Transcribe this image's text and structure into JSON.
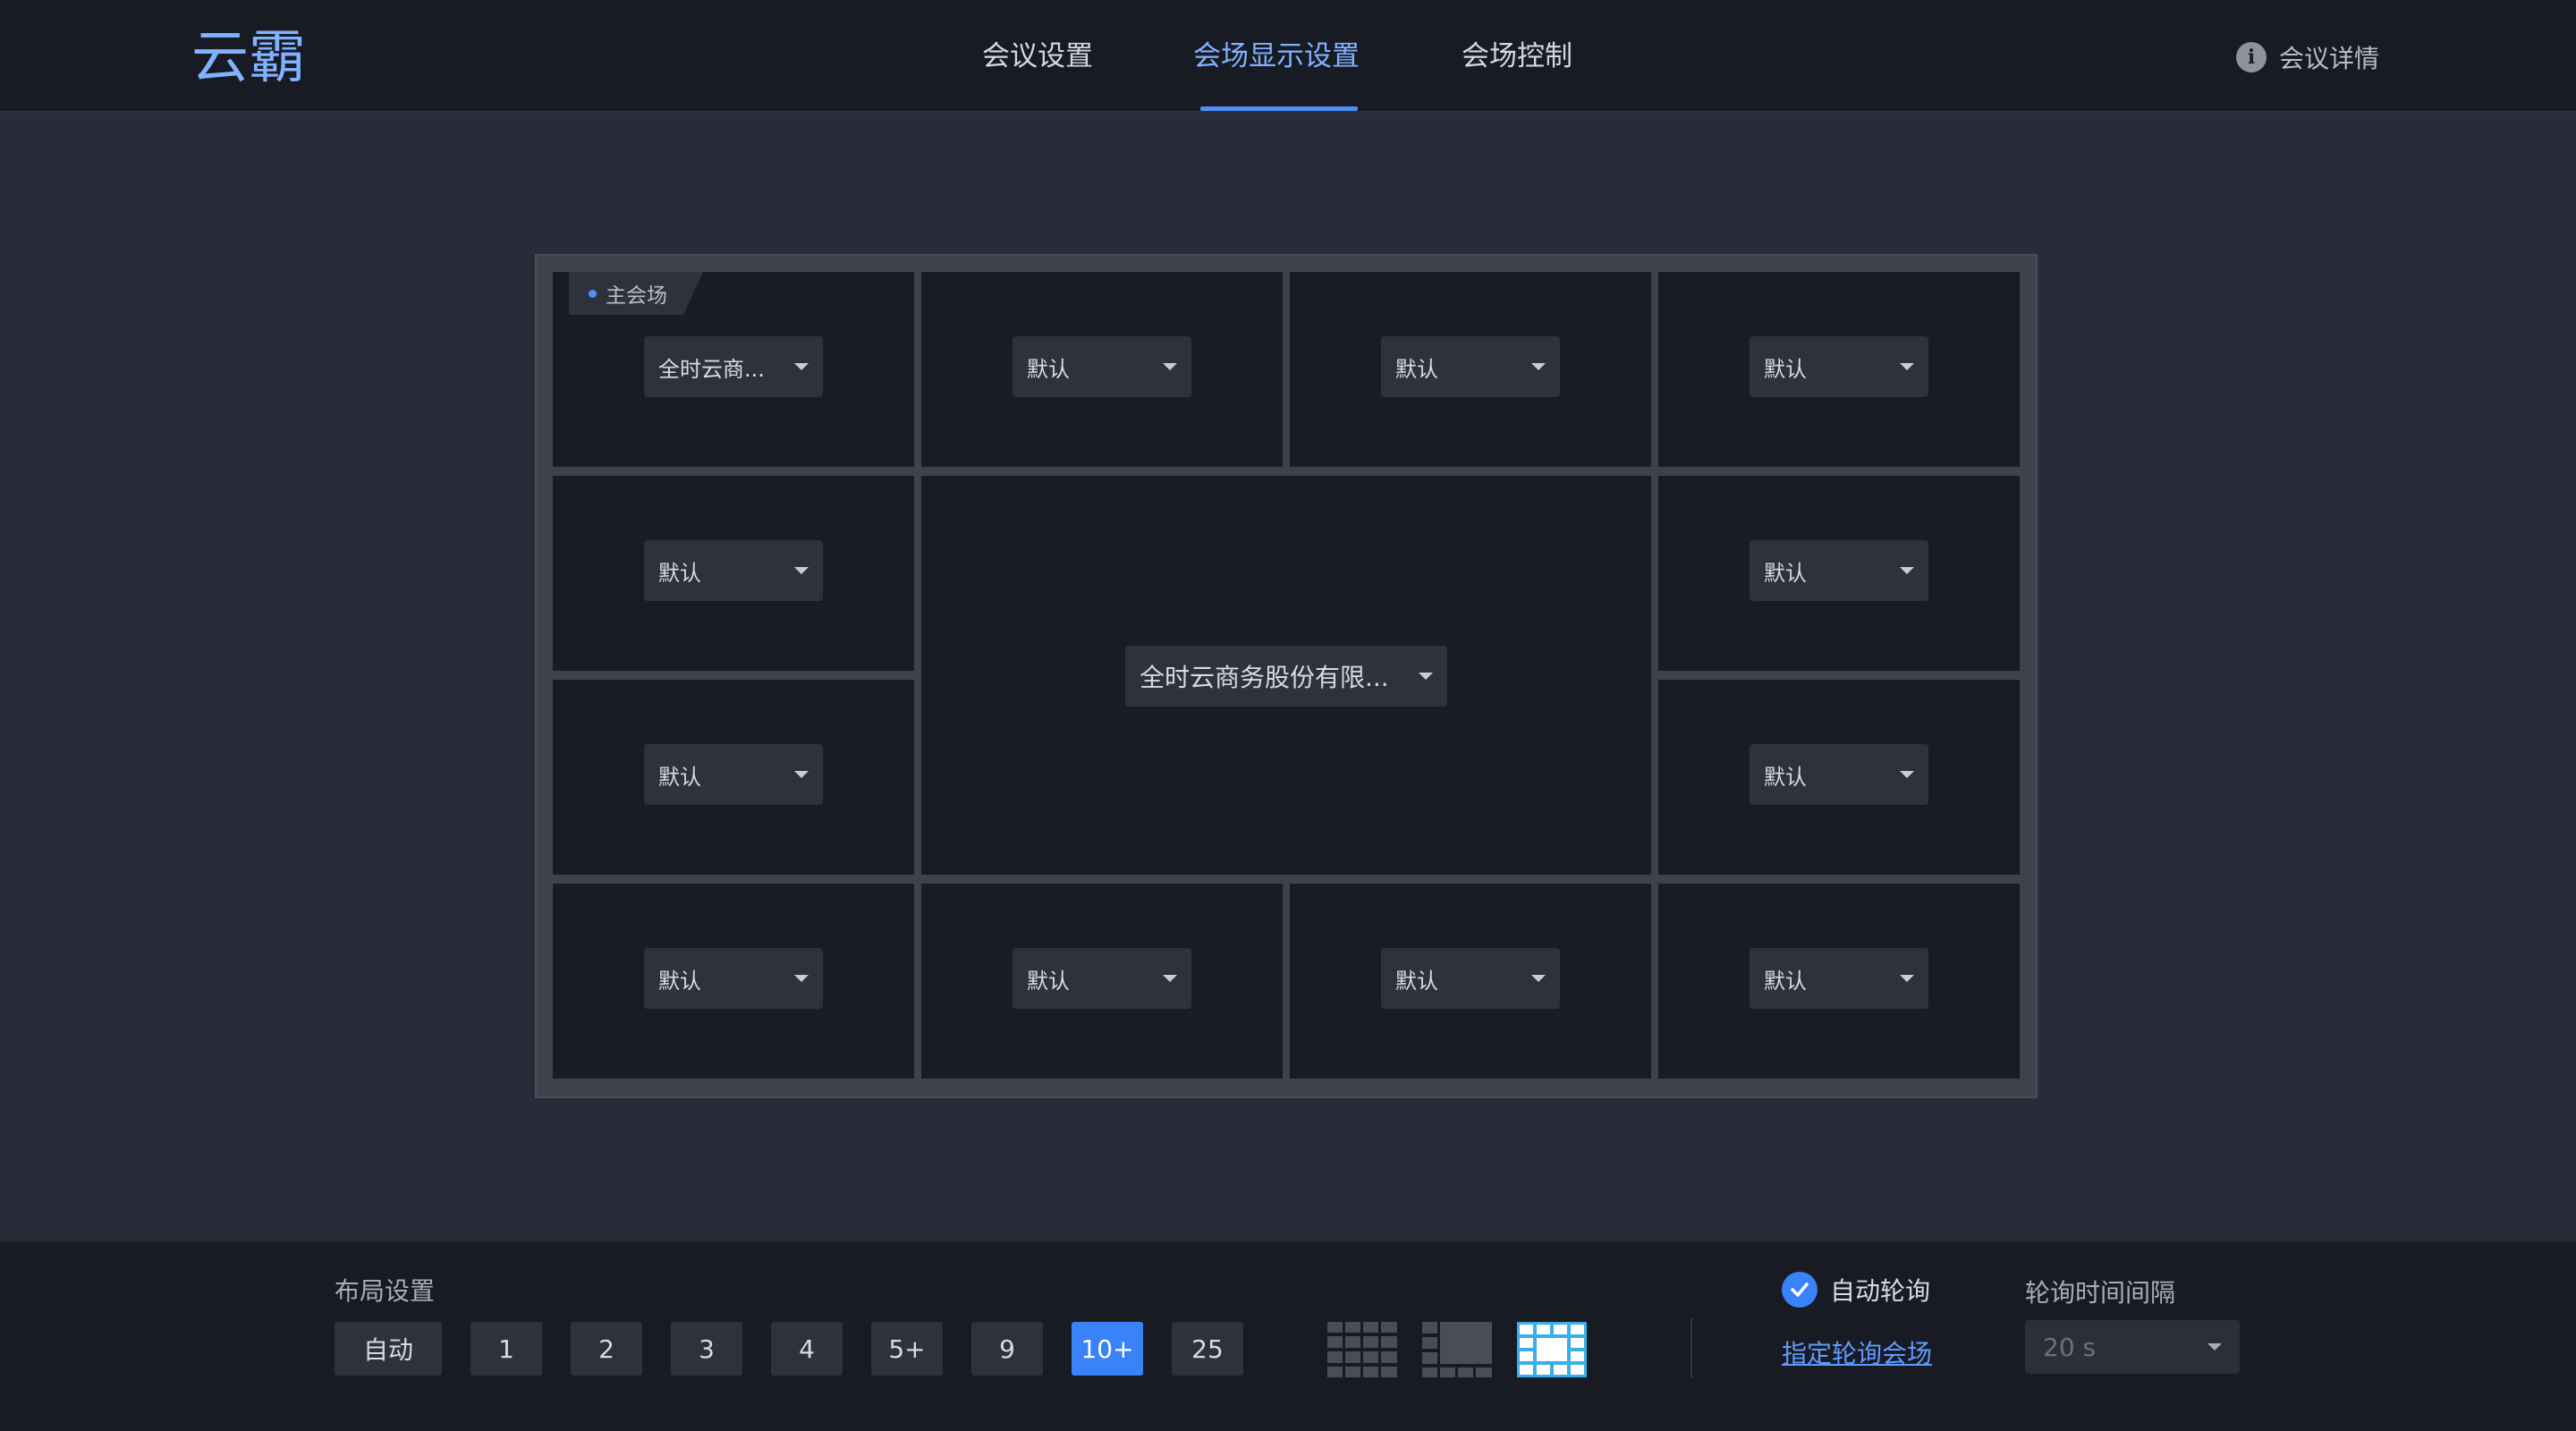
{
  "app": {
    "logo_text": "云霸"
  },
  "nav": {
    "tabs": [
      {
        "label": "会议设置"
      },
      {
        "label": "会场显示设置",
        "active": true
      },
      {
        "label": "会场控制"
      }
    ],
    "details_label": "会议详情"
  },
  "screen": {
    "main_tag": "主会场",
    "cells": [
      {
        "value": "全时云商..."
      },
      {
        "value": "默认"
      },
      {
        "value": "默认"
      },
      {
        "value": "默认"
      },
      {
        "value": "默认"
      },
      {
        "value": "全时云商务股份有限..."
      },
      {
        "value": "默认"
      },
      {
        "value": "默认"
      },
      {
        "value": "默认"
      },
      {
        "value": "默认"
      },
      {
        "value": "默认"
      },
      {
        "value": "默认"
      },
      {
        "value": "默认"
      }
    ]
  },
  "layout": {
    "title": "布局设置",
    "options": [
      {
        "label": "自动"
      },
      {
        "label": "1"
      },
      {
        "label": "2"
      },
      {
        "label": "3"
      },
      {
        "label": "4"
      },
      {
        "label": "5+"
      },
      {
        "label": "9"
      },
      {
        "label": "10+",
        "active": true
      },
      {
        "label": "25"
      }
    ],
    "modes": [
      {
        "icon": "grid-equal-icon"
      },
      {
        "icon": "grid-focus-icon"
      },
      {
        "icon": "grid-surround-icon",
        "active": true
      }
    ]
  },
  "polling": {
    "auto_label": "自动轮询",
    "auto_checked": true,
    "assign_link": "指定轮询会场",
    "interval_title": "轮询时间间隔",
    "interval_value": "20 s"
  },
  "colors": {
    "accent": "#3a82f7",
    "header_bg": "#191b24",
    "page_bg": "#282b38",
    "cell_bg": "#1a1c25"
  }
}
